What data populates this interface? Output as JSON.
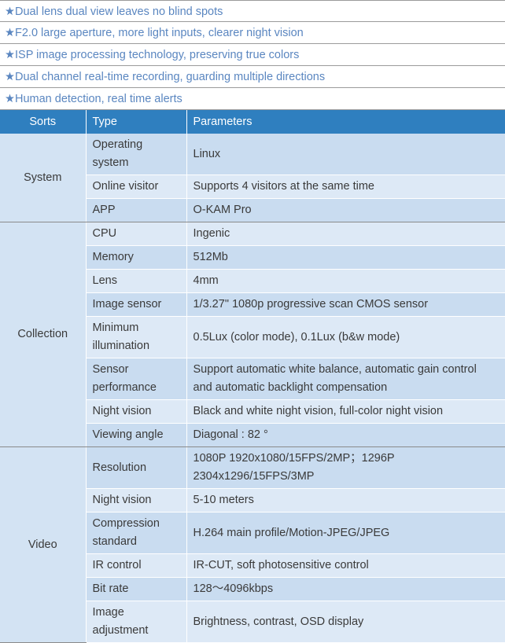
{
  "features": [
    "Dual lens dual view leaves no blind spots",
    "F2.0 large aperture, more light inputs, clearer night vision",
    "ISP image processing technology, preserving true colors",
    "Dual channel real-time recording, guarding multiple directions",
    "Human detection, real time alerts"
  ],
  "star": "★",
  "table": {
    "headers": {
      "sorts": "Sorts",
      "type": "Type",
      "parameters": "Parameters"
    },
    "sections": [
      {
        "name": "System",
        "rows": [
          {
            "type": "Operating system",
            "param": "Linux"
          },
          {
            "type": "Online visitor",
            "param": "Supports 4 visitors at the same time"
          },
          {
            "type": "APP",
            "param": "O-KAM Pro"
          }
        ]
      },
      {
        "name": "Collection",
        "rows": [
          {
            "type": "CPU",
            "param": "Ingenic"
          },
          {
            "type": "Memory",
            "param": "512Mb"
          },
          {
            "type": "Lens",
            "param": "4mm"
          },
          {
            "type": "Image sensor",
            "param": "1/3.27\" 1080p progressive scan CMOS sensor"
          },
          {
            "type": "Minimum illumination",
            "param": "0.5Lux (color mode), 0.1Lux (b&w mode)"
          },
          {
            "type": "Sensor performance",
            "param": "Support automatic white balance, automatic gain control and automatic backlight compensation"
          },
          {
            "type": "Night vision",
            "param": "Black and white night vision, full-color night vision"
          },
          {
            "type": "Viewing angle",
            "param": "Diagonal : 82 °"
          }
        ]
      },
      {
        "name": "Video",
        "rows": [
          {
            "type": "Resolution",
            "param": "1080P 1920x1080/15FPS/2MP；1296P 2304x1296/15FPS/3MP"
          },
          {
            "type": "Night vision",
            "param": "5-10 meters"
          },
          {
            "type": "Compression standard",
            "param": "H.264 main profile/Motion-JPEG/JPEG"
          },
          {
            "type": "IR control",
            "param": "IR-CUT, soft photosensitive control"
          },
          {
            "type": "Bit rate",
            "param": "128～4096kbps"
          },
          {
            "type": "Image adjustment",
            "param": "Brightness, contrast, OSD display"
          }
        ]
      }
    ]
  },
  "colors": {
    "feature_text": "#5a86c0",
    "header_bg": "#2f7fbf",
    "row_dark": "#c9dcf0",
    "row_light": "#dde9f6"
  }
}
